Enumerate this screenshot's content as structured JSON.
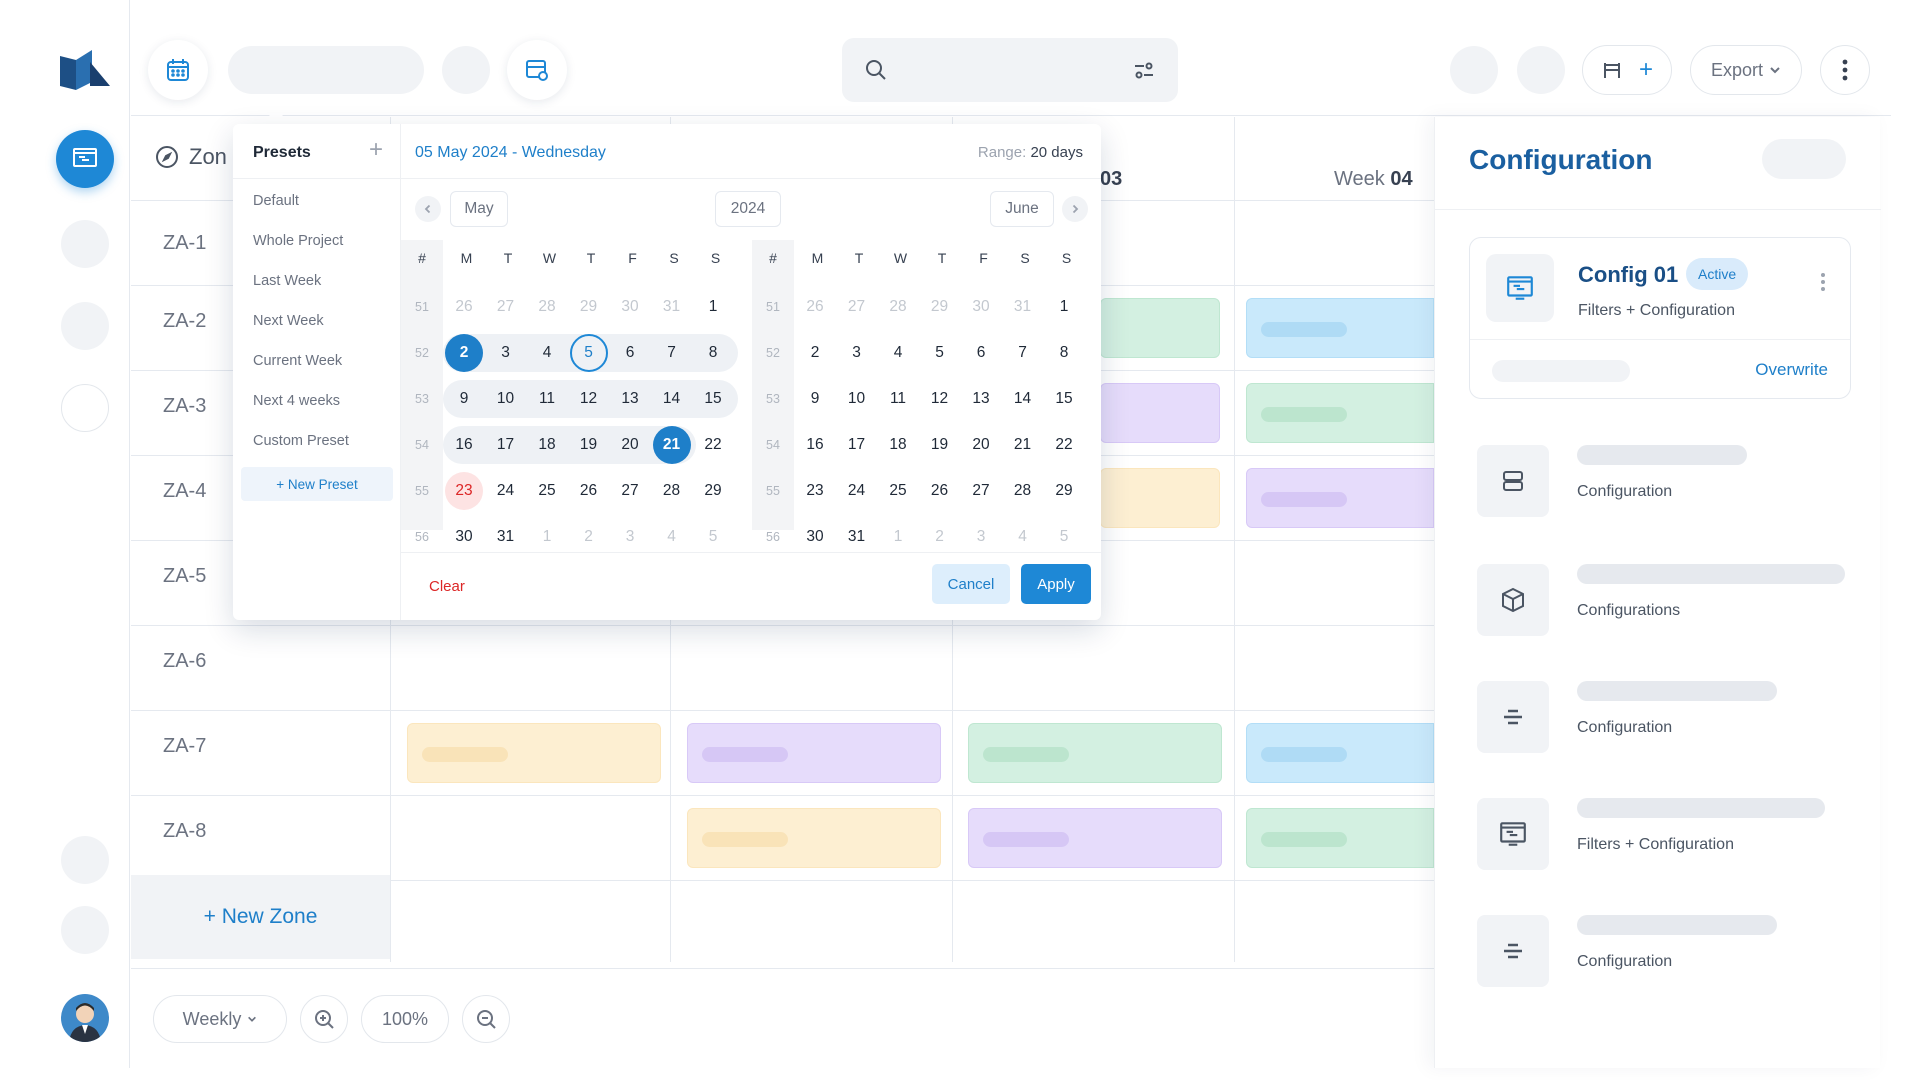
{
  "sidebar": {
    "logo": "app-logo",
    "active_icon": "presentation-icon"
  },
  "topbar": {
    "export_label": "Export",
    "add_symbol": "+"
  },
  "grid": {
    "zone_header": "Zon",
    "weeks": [
      {
        "prefix": "",
        "num": "03"
      },
      {
        "prefix": "Week ",
        "num": "04"
      }
    ],
    "rows": [
      "ZA-1",
      "ZA-2",
      "ZA-3",
      "ZA-4",
      "ZA-5",
      "ZA-6",
      "ZA-7",
      "ZA-8"
    ],
    "new_zone_label": "+ New Zone"
  },
  "bottom": {
    "view_label": "Weekly",
    "zoom_label": "100%"
  },
  "picker": {
    "presets_title": "Presets",
    "presets": [
      "Default",
      "Whole Project",
      "Last Week",
      "Next Week",
      "Current Week",
      "Next 4 weeks",
      "Custom Preset"
    ],
    "new_preset_label": "+ New Preset",
    "selected_date_label": "05 May 2024 - Wednesday",
    "range_prefix": "Range:",
    "range_value": "20 days",
    "left_month": "May",
    "year": "2024",
    "right_month": "June",
    "dow": [
      "#",
      "M",
      "T",
      "W",
      "T",
      "F",
      "S",
      "S"
    ],
    "week_numbers": [
      "51",
      "52",
      "53",
      "54",
      "55",
      "56"
    ],
    "left_days": [
      [
        "26",
        "27",
        "28",
        "29",
        "30",
        "31",
        "1"
      ],
      [
        "2",
        "3",
        "4",
        "5",
        "6",
        "7",
        "8"
      ],
      [
        "9",
        "10",
        "11",
        "12",
        "13",
        "14",
        "15"
      ],
      [
        "16",
        "17",
        "18",
        "19",
        "20",
        "21",
        "22"
      ],
      [
        "23",
        "24",
        "25",
        "26",
        "27",
        "28",
        "29"
      ],
      [
        "30",
        "31",
        "1",
        "2",
        "3",
        "4",
        "5"
      ]
    ],
    "right_days": [
      [
        "26",
        "27",
        "28",
        "29",
        "30",
        "31",
        "1"
      ],
      [
        "2",
        "3",
        "4",
        "5",
        "6",
        "7",
        "8"
      ],
      [
        "9",
        "10",
        "11",
        "12",
        "13",
        "14",
        "15"
      ],
      [
        "16",
        "17",
        "18",
        "19",
        "20",
        "21",
        "22"
      ],
      [
        "23",
        "24",
        "25",
        "26",
        "27",
        "28",
        "29"
      ],
      [
        "30",
        "31",
        "1",
        "2",
        "3",
        "4",
        "5"
      ]
    ],
    "clear_label": "Clear",
    "cancel_label": "Cancel",
    "apply_label": "Apply"
  },
  "panel": {
    "title": "Configuration",
    "card": {
      "title": "Config 01",
      "badge": "Active",
      "subtitle": "Filters + Configuration",
      "action": "Overwrite"
    },
    "items": [
      {
        "icon": "layers-icon",
        "label": "Configuration"
      },
      {
        "icon": "cube-icon",
        "label": "Configurations"
      },
      {
        "icon": "align-center-icon",
        "label": "Configuration"
      },
      {
        "icon": "presentation-icon",
        "label": "Filters + Configuration"
      },
      {
        "icon": "align-center-icon",
        "label": "Configuration"
      }
    ]
  },
  "colors": {
    "accent": "#1e88d6",
    "yellow": "#fdefd2",
    "purple": "#e6dcfb",
    "green": "#d3f0e1",
    "blue": "#c9e9fb"
  }
}
